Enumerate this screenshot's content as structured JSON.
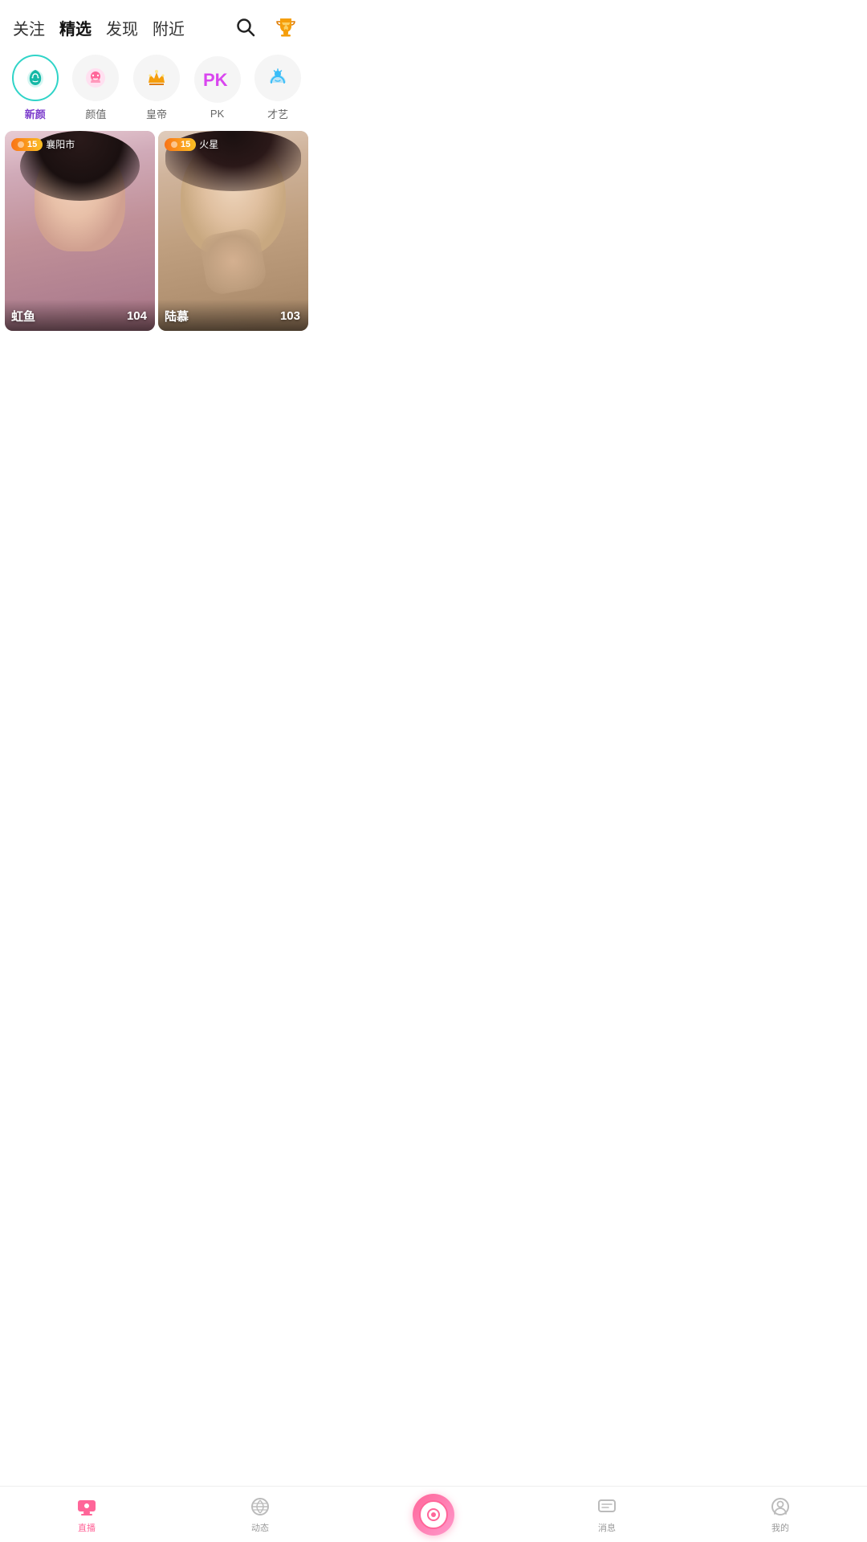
{
  "header": {
    "tabs": [
      {
        "id": "follow",
        "label": "关注",
        "active": false
      },
      {
        "id": "featured",
        "label": "精选",
        "active": true
      },
      {
        "id": "discover",
        "label": "发现",
        "active": false
      },
      {
        "id": "nearby",
        "label": "附近",
        "active": false
      }
    ],
    "search_icon": "search",
    "trophy_icon": "trophy"
  },
  "categories": [
    {
      "id": "new-face",
      "label": "新颜",
      "icon": "leaf",
      "active": true
    },
    {
      "id": "looks",
      "label": "颜值",
      "icon": "face",
      "active": false
    },
    {
      "id": "emperor",
      "label": "皇帝",
      "icon": "crown",
      "active": false
    },
    {
      "id": "pk",
      "label": "PK",
      "icon": "pk",
      "active": false
    },
    {
      "id": "talent",
      "label": "才艺",
      "icon": "chat-bubble",
      "active": false
    }
  ],
  "streams": [
    {
      "id": 1,
      "streamer_name": "虹鱼",
      "level": "15",
      "location": "襄阳市",
      "viewer_count": "104",
      "bg_color_start": "#e8c4cc",
      "bg_color_end": "#c4a0a8"
    },
    {
      "id": 2,
      "streamer_name": "陆慕",
      "level": "15",
      "location": "火星",
      "viewer_count": "103",
      "bg_color_start": "#d4b8b0",
      "bg_color_end": "#b89888"
    }
  ],
  "bottom_nav": [
    {
      "id": "live",
      "label": "直播",
      "active": true,
      "icon": "tv"
    },
    {
      "id": "moments",
      "label": "动态",
      "active": false,
      "icon": "leaf2"
    },
    {
      "id": "center",
      "label": "",
      "active": false,
      "icon": "camera"
    },
    {
      "id": "messages",
      "label": "消息",
      "active": false,
      "icon": "chat"
    },
    {
      "id": "mine",
      "label": "我的",
      "active": false,
      "icon": "face2"
    }
  ]
}
